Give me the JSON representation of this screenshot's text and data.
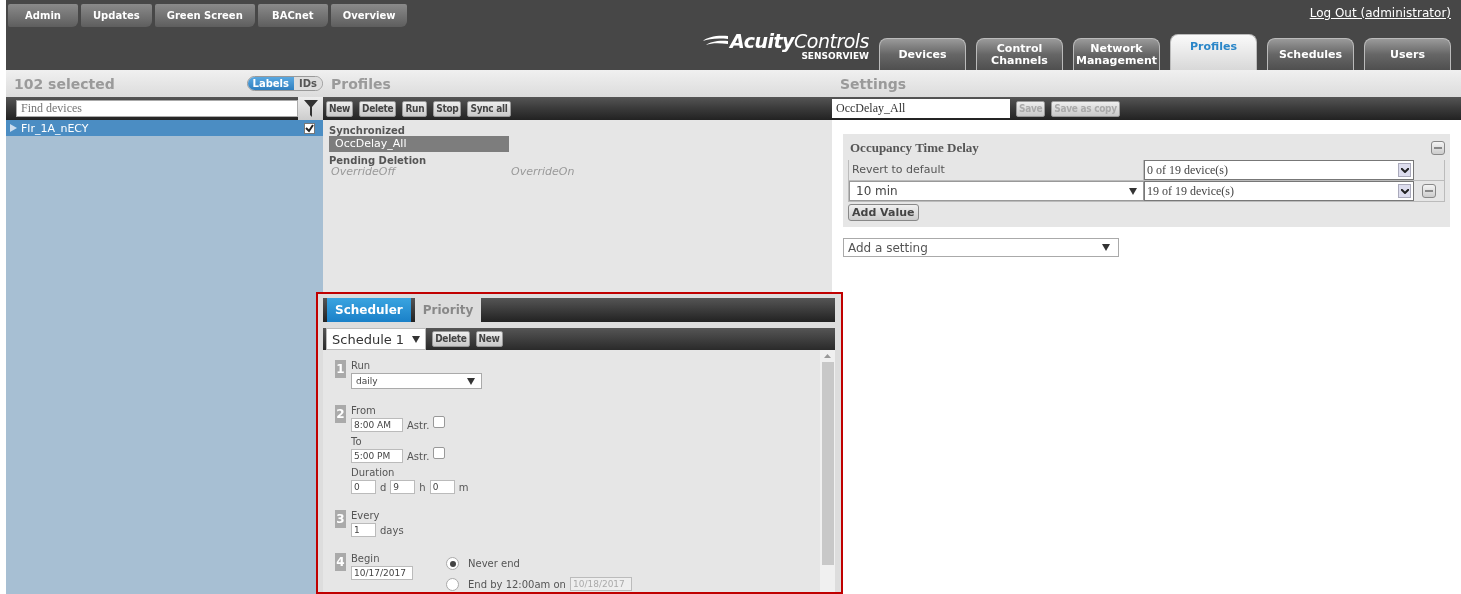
{
  "top_nav": [
    {
      "label": "Admin"
    },
    {
      "label": "Updates"
    },
    {
      "label": "Green Screen"
    },
    {
      "label": "BACnet"
    },
    {
      "label": "Overview"
    }
  ],
  "logout": "Log Out (administrator)",
  "logo": {
    "brand": "**Acuity**Controls",
    "tagline": "SENSORVIEW"
  },
  "main_tabs": [
    {
      "label": "Devices",
      "selected": false
    },
    {
      "label": "Control\nChannels",
      "selected": false
    },
    {
      "label": "Network\nManagement",
      "selected": false
    },
    {
      "label": "Profiles",
      "selected": true
    },
    {
      "label": "Schedules",
      "selected": false
    },
    {
      "label": "Users",
      "selected": false
    }
  ],
  "devices": {
    "title": "102 selected",
    "view_toggle": [
      {
        "label": "Labels",
        "selected": true
      },
      {
        "label": "IDs",
        "selected": false
      }
    ],
    "search": {
      "placeholder": "Find devices"
    },
    "items": [
      {
        "label": "Flr_1A_nECY",
        "selected": true,
        "checked": true,
        "expanded": false
      }
    ]
  },
  "profiles": {
    "title": "Profiles",
    "toolbar": [
      "New",
      "Delete",
      "Run",
      "Stop",
      "Sync all"
    ],
    "groups": [
      {
        "heading": "Synchronized",
        "kind": "synced",
        "items": [
          {
            "label": "OccDelay_All",
            "selected": true
          }
        ]
      },
      {
        "heading": "Pending Deletion",
        "kind": "pending",
        "items": [
          {
            "label": "OverrideOff",
            "selected": false
          },
          {
            "label": "OverrideOn",
            "selected": false
          }
        ]
      }
    ]
  },
  "scheduler": {
    "tabs": [
      {
        "label": "Scheduler",
        "selected": true
      },
      {
        "label": "Priority",
        "selected": false
      }
    ],
    "schedule": "Schedule 1",
    "buttons": [
      "Delete",
      "New"
    ],
    "steps": [
      {
        "number": "1",
        "fields": [
          {
            "kind": "select",
            "label": "Run",
            "value": "daily"
          }
        ]
      },
      {
        "number": "2",
        "fields": [
          {
            "kind": "time",
            "label": "From",
            "value": "8:00 AM",
            "option": "Astr.",
            "checked": false
          },
          {
            "kind": "time",
            "label": "To",
            "value": "5:00 PM",
            "option": "Astr.",
            "checked": false
          },
          {
            "kind": "duration",
            "label": "Duration",
            "parts": [
              {
                "value": "0",
                "unit": "d"
              },
              {
                "value": "9",
                "unit": "h"
              },
              {
                "value": "0",
                "unit": "m"
              }
            ]
          }
        ]
      },
      {
        "number": "3",
        "fields": [
          {
            "kind": "interval",
            "label": "Every",
            "value": "1",
            "unit": "days"
          }
        ]
      },
      {
        "number": "4",
        "fields": [
          {
            "kind": "date",
            "label": "Begin",
            "value": "10/17/2017"
          }
        ],
        "end_options": [
          {
            "label": "Never end",
            "selected": true
          },
          {
            "label": "End by 12:00am on",
            "selected": false,
            "date": "10/18/2017"
          }
        ]
      }
    ]
  },
  "settings": {
    "title": "Settings",
    "name": "OccDelay_All",
    "buttons": [
      {
        "label": "Save",
        "disabled": true
      },
      {
        "label": "Save as copy",
        "disabled": true
      }
    ],
    "card": {
      "title": "Occupancy Time Delay",
      "rows": [
        {
          "kind": "default",
          "label": "Revert to default",
          "devices": "0 of 19 device(s)"
        },
        {
          "kind": "value",
          "value": "10 min",
          "devices": "19 of 19 device(s)"
        }
      ],
      "add_button": "Add Value"
    },
    "add_setting": "Add a setting"
  }
}
